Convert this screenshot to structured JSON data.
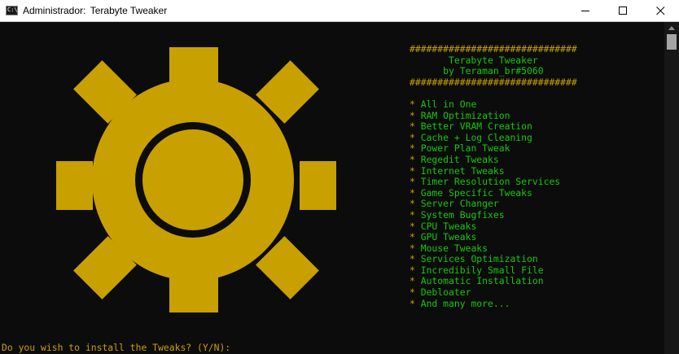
{
  "window": {
    "title_prefix": "Administrador:",
    "title": "Terabyte Tweaker",
    "icon": "cmd-icon",
    "icon_text": "C:\\"
  },
  "terminal": {
    "header_border": "##############################",
    "header_title": "       Terabyte Tweaker",
    "header_author": "      by Teraman_br#5060",
    "bullet": "* ",
    "menu_items": [
      "All in One",
      "RAM Optimization",
      "Better VRAM Creation",
      "Cache + Log Cleaning",
      "Power Plan Tweak",
      "Regedit Tweaks",
      "Internet Tweaks",
      "Timer Resolution Services",
      "Game Specific Tweaks",
      "Server Changer",
      "System Bugfixes",
      "CPU Tweaks",
      "GPU Tweaks",
      "Mouse Tweaks",
      "Services Optimization",
      "Incredibily Small File",
      "Automatic Installation",
      "Debloater",
      "And many more..."
    ],
    "prompt": "Do you wish to install the Tweaks? (Y/N): "
  },
  "colors": {
    "background": "#0c0c0c",
    "yellow": "#c8a000",
    "green": "#16c60c",
    "gear": "#c8a000"
  },
  "logo": {
    "icon": "gear-lightning-logo"
  }
}
